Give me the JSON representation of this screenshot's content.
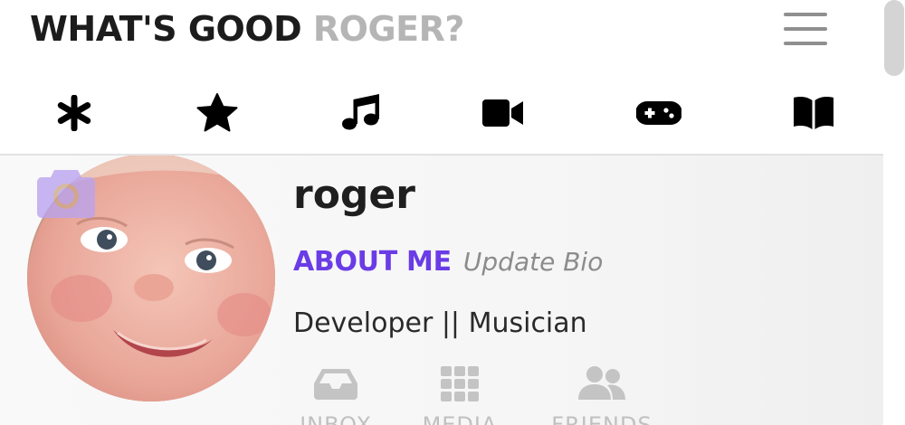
{
  "header": {
    "greeting": "WHAT'S GOOD",
    "user_name": "ROGER?",
    "menu_icon": "hamburger-menu-icon"
  },
  "category_nav": {
    "items": [
      {
        "icon": "asterisk-icon",
        "label": "All"
      },
      {
        "icon": "star-icon",
        "label": "Favorites"
      },
      {
        "icon": "music-icon",
        "label": "Music"
      },
      {
        "icon": "video-camera-icon",
        "label": "Video"
      },
      {
        "icon": "gamepad-icon",
        "label": "Games"
      },
      {
        "icon": "book-icon",
        "label": "Books"
      }
    ]
  },
  "profile": {
    "username": "roger",
    "about_label": "ABOUT ME",
    "update_bio_label": "Update Bio",
    "bio": "Developer || Musician",
    "camera_icon": "camera-icon",
    "tabs": [
      {
        "icon": "inbox-icon",
        "label": "INBOX"
      },
      {
        "icon": "media-grid-icon",
        "label": "MEDIA"
      },
      {
        "icon": "friends-icon",
        "label": "FRIENDS"
      }
    ]
  },
  "colors": {
    "accent": "#6a3ce6",
    "text_dark": "#1c1c1c",
    "text_muted": "#b5b5b5",
    "icon_gray": "#c4c4c4",
    "camera_overlay": "#b9a3f0"
  }
}
